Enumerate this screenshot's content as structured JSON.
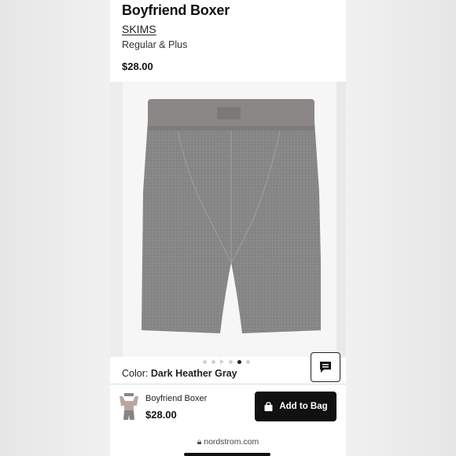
{
  "product": {
    "title": "Boyfriend Boxer",
    "brand": "SKIMS",
    "sizes": "Regular & Plus",
    "price": "$28.00"
  },
  "gallery": {
    "image_icon": "boxer-brief-image",
    "dot_count": 6,
    "active_index": 4
  },
  "color": {
    "label": "Color:",
    "value": "Dark Heather Gray"
  },
  "sticky_bar": {
    "name": "Boyfriend Boxer",
    "price": "$28.00",
    "add_label": "Add to Bag"
  },
  "browser": {
    "url": "nordstrom.com"
  },
  "colors": {
    "fabric": "#858585",
    "waistband": "#8a8685",
    "button": "#111111"
  }
}
